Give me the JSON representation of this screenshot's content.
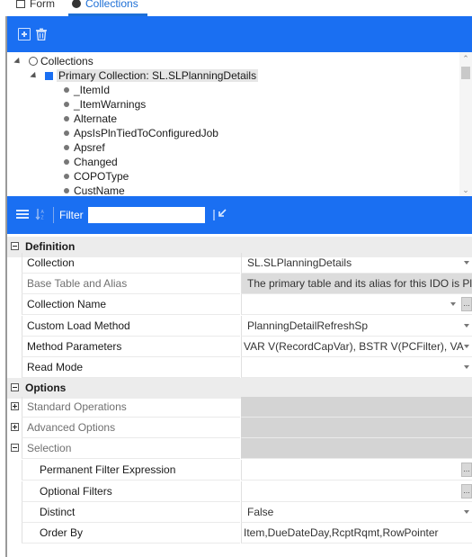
{
  "tabs": [
    {
      "label": "Form",
      "active": false
    },
    {
      "label": "Collections",
      "active": true
    }
  ],
  "toolbar1": {
    "icons": [
      "add-icon",
      "trash-icon"
    ]
  },
  "tree": {
    "root": "Collections",
    "primary": "Primary Collection: SL.SLPlanningDetails",
    "items": [
      "_ItemId",
      "_ItemWarnings",
      "Alternate",
      "ApsIsPlnTiedToConfiguredJob",
      "Apsref",
      "Changed",
      "COPOType",
      "CustName"
    ]
  },
  "toolbar2": {
    "filter_label": "Filter",
    "filter_value": ""
  },
  "categories": {
    "definition": "Definition",
    "options": "Options"
  },
  "properties": {
    "collection": {
      "name": "Collection",
      "value": "SL.SLPlanningDetails"
    },
    "base_table": {
      "name": "Base Table and Alias",
      "value": "The primary table and its alias for this IDO is Pla"
    },
    "collection_name": {
      "name": "Collection Name",
      "value": ""
    },
    "custom_load": {
      "name": "Custom Load Method",
      "value": "PlanningDetailRefreshSp"
    },
    "method_params": {
      "name": "Method Parameters",
      "value": "VAR V(RecordCapVar), BSTR V(PCFilter), VA"
    },
    "read_mode": {
      "name": "Read Mode",
      "value": ""
    },
    "standard_ops": {
      "name": "Standard Operations",
      "value": ""
    },
    "advanced_opts": {
      "name": "Advanced Options",
      "value": ""
    },
    "selection": {
      "name": "Selection",
      "value": ""
    },
    "perm_filter": {
      "name": "Permanent Filter Expression",
      "value": ""
    },
    "optional_filters": {
      "name": "Optional Filters",
      "value": ""
    },
    "distinct": {
      "name": "Distinct",
      "value": "False"
    },
    "order_by": {
      "name": "Order By",
      "value": "Item,DueDateDay,RcptRqmt,RowPointer"
    }
  },
  "ellipsis": "..."
}
